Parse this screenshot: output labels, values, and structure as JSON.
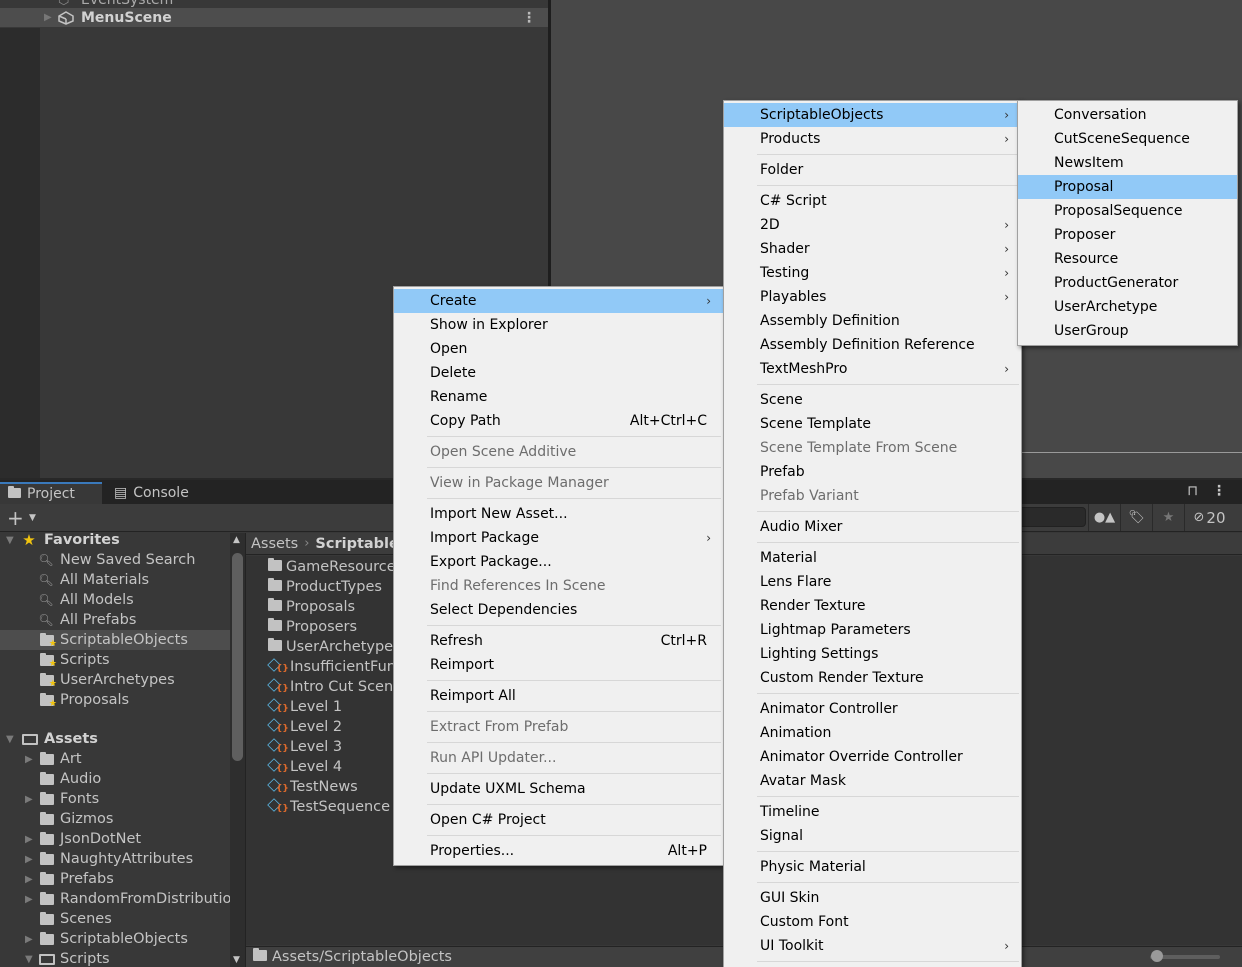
{
  "hierarchy": {
    "partial_item": "EventSystem",
    "scene_item": "MenuScene"
  },
  "project_window": {
    "tabs": [
      {
        "label": "Project",
        "icon": "folder-icon",
        "active": true
      },
      {
        "label": "Console",
        "icon": "console-icon",
        "active": false
      }
    ],
    "toolbar": {
      "add_label": "+",
      "hidden_count": "20"
    },
    "favorites": {
      "label": "Favorites",
      "items": [
        {
          "label": "New Saved Search",
          "icon": "search-icon"
        },
        {
          "label": "All Materials",
          "icon": "search-icon"
        },
        {
          "label": "All Models",
          "icon": "search-icon"
        },
        {
          "label": "All Prefabs",
          "icon": "search-icon"
        },
        {
          "label": "ScriptableObjects",
          "icon": "favorite-folder-icon",
          "selected": true
        },
        {
          "label": "Scripts",
          "icon": "favorite-folder-icon"
        },
        {
          "label": "UserArchetypes",
          "icon": "favorite-folder-icon"
        },
        {
          "label": "Proposals",
          "icon": "favorite-folder-icon"
        }
      ]
    },
    "assets": {
      "label": "Assets",
      "items": [
        {
          "label": "Art",
          "expandable": true
        },
        {
          "label": "Audio",
          "expandable": false
        },
        {
          "label": "Fonts",
          "expandable": true
        },
        {
          "label": "Gizmos",
          "expandable": false
        },
        {
          "label": "JsonDotNet",
          "expandable": true
        },
        {
          "label": "NaughtyAttributes",
          "expandable": true
        },
        {
          "label": "Prefabs",
          "expandable": true
        },
        {
          "label": "RandomFromDistributio",
          "expandable": true
        },
        {
          "label": "Scenes",
          "expandable": false
        },
        {
          "label": "ScriptableObjects",
          "expandable": true
        },
        {
          "label": "Scripts",
          "expandable": true,
          "expanded": true
        }
      ]
    },
    "breadcrumb": {
      "root": "Assets",
      "current": "Scriptable"
    },
    "files": [
      {
        "label": "GameResource",
        "type": "folder"
      },
      {
        "label": "ProductTypes",
        "type": "folder"
      },
      {
        "label": "Proposals",
        "type": "folder"
      },
      {
        "label": "Proposers",
        "type": "folder"
      },
      {
        "label": "UserArchetype",
        "type": "folder"
      },
      {
        "label": "InsufficientFun",
        "type": "scriptable-object"
      },
      {
        "label": "Intro Cut Scene",
        "type": "scriptable-object"
      },
      {
        "label": "Level 1",
        "type": "scriptable-object"
      },
      {
        "label": "Level 2",
        "type": "scriptable-object"
      },
      {
        "label": "Level 3",
        "type": "scriptable-object"
      },
      {
        "label": "Level 4",
        "type": "scriptable-object"
      },
      {
        "label": "TestNews",
        "type": "scriptable-object"
      },
      {
        "label": "TestSequence",
        "type": "scriptable-object"
      }
    ],
    "status_path": "Assets/ScriptableObjects"
  },
  "context_menu": {
    "items": [
      {
        "label": "Create",
        "submenu": true,
        "highlight": true
      },
      {
        "label": "Show in Explorer"
      },
      {
        "label": "Open"
      },
      {
        "label": "Delete"
      },
      {
        "label": "Rename"
      },
      {
        "label": "Copy Path",
        "shortcut": "Alt+Ctrl+C"
      },
      {
        "separator": true
      },
      {
        "label": "Open Scene Additive",
        "disabled": true
      },
      {
        "separator": true
      },
      {
        "label": "View in Package Manager",
        "disabled": true
      },
      {
        "separator": true
      },
      {
        "label": "Import New Asset..."
      },
      {
        "label": "Import Package",
        "submenu": true
      },
      {
        "label": "Export Package..."
      },
      {
        "label": "Find References In Scene",
        "disabled": true
      },
      {
        "label": "Select Dependencies"
      },
      {
        "separator": true
      },
      {
        "label": "Refresh",
        "shortcut": "Ctrl+R"
      },
      {
        "label": "Reimport"
      },
      {
        "separator": true
      },
      {
        "label": "Reimport All"
      },
      {
        "separator": true
      },
      {
        "label": "Extract From Prefab",
        "disabled": true
      },
      {
        "separator": true
      },
      {
        "label": "Run API Updater...",
        "disabled": true
      },
      {
        "separator": true
      },
      {
        "label": "Update UXML Schema"
      },
      {
        "separator": true
      },
      {
        "label": "Open C# Project"
      },
      {
        "separator": true
      },
      {
        "label": "Properties...",
        "shortcut": "Alt+P"
      }
    ]
  },
  "create_menu": {
    "items": [
      {
        "label": "ScriptableObjects",
        "submenu": true,
        "highlight": true
      },
      {
        "label": "Products",
        "submenu": true
      },
      {
        "separator": true
      },
      {
        "label": "Folder"
      },
      {
        "separator": true
      },
      {
        "label": "C# Script"
      },
      {
        "label": "2D",
        "submenu": true
      },
      {
        "label": "Shader",
        "submenu": true
      },
      {
        "label": "Testing",
        "submenu": true
      },
      {
        "label": "Playables",
        "submenu": true
      },
      {
        "label": "Assembly Definition"
      },
      {
        "label": "Assembly Definition Reference"
      },
      {
        "label": "TextMeshPro",
        "submenu": true
      },
      {
        "separator": true
      },
      {
        "label": "Scene"
      },
      {
        "label": "Scene Template"
      },
      {
        "label": "Scene Template From Scene",
        "disabled": true
      },
      {
        "label": "Prefab"
      },
      {
        "label": "Prefab Variant",
        "disabled": true
      },
      {
        "separator": true
      },
      {
        "label": "Audio Mixer"
      },
      {
        "separator": true
      },
      {
        "label": "Material"
      },
      {
        "label": "Lens Flare"
      },
      {
        "label": "Render Texture"
      },
      {
        "label": "Lightmap Parameters"
      },
      {
        "label": "Lighting Settings"
      },
      {
        "label": "Custom Render Texture"
      },
      {
        "separator": true
      },
      {
        "label": "Animator Controller"
      },
      {
        "label": "Animation"
      },
      {
        "label": "Animator Override Controller"
      },
      {
        "label": "Avatar Mask"
      },
      {
        "separator": true
      },
      {
        "label": "Timeline"
      },
      {
        "label": "Signal"
      },
      {
        "separator": true
      },
      {
        "label": "Physic Material"
      },
      {
        "separator": true
      },
      {
        "label": "GUI Skin"
      },
      {
        "label": "Custom Font"
      },
      {
        "label": "UI Toolkit",
        "submenu": true
      },
      {
        "separator": true
      }
    ]
  },
  "scriptable_objects_menu": {
    "items": [
      {
        "label": "Conversation"
      },
      {
        "label": "CutSceneSequence"
      },
      {
        "label": "NewsItem"
      },
      {
        "label": "Proposal",
        "highlight": true
      },
      {
        "label": "ProposalSequence"
      },
      {
        "label": "Proposer"
      },
      {
        "label": "Resource"
      },
      {
        "label": "ProductGenerator"
      },
      {
        "label": "UserArchetype"
      },
      {
        "label": "UserGroup"
      }
    ]
  },
  "colors": {
    "menu_highlight": "#91c9f7",
    "menu_background": "#f0f0f0",
    "editor_background": "#383838",
    "scene_background": "#484848",
    "favorite_star": "#f1c40f",
    "active_tab_accent": "#3a79bb"
  }
}
